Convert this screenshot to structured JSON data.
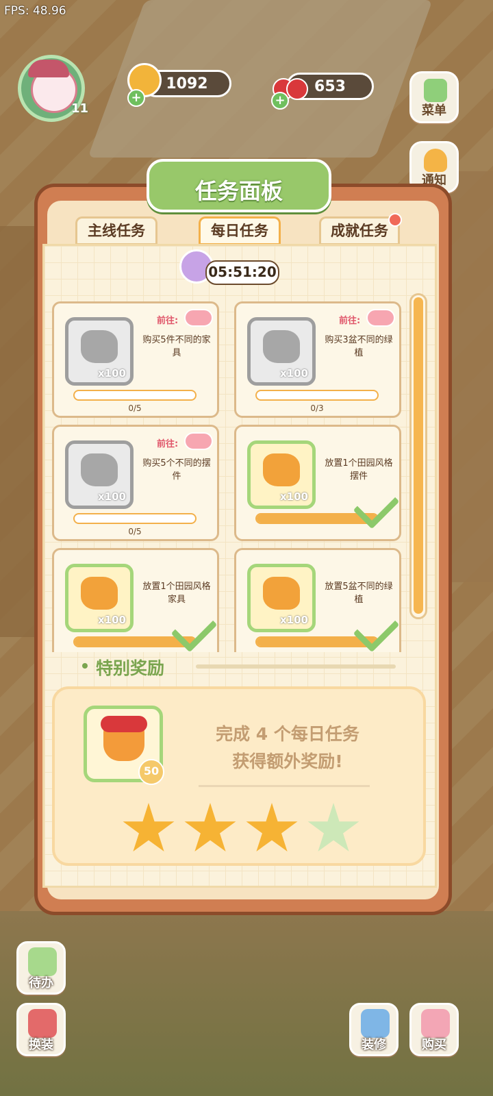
{
  "fps": "FPS: 48.96",
  "player": {
    "level": "11"
  },
  "resources": {
    "coins": "1092",
    "cherries": "653"
  },
  "side_buttons": {
    "menu": "菜单",
    "notice": "通知"
  },
  "panel": {
    "title": "任务面板",
    "tabs": [
      {
        "label": "主线任务"
      },
      {
        "label": "每日任务"
      },
      {
        "label": "成就任务"
      }
    ],
    "timer": "05:51:20",
    "tasks": [
      {
        "desc": "购买5件不同的家具",
        "goto": "前往:",
        "qty": "x100",
        "progress": "0/5",
        "progress_fraction": 0,
        "done": false
      },
      {
        "desc": "购买3盆不同的绿植",
        "goto": "前往:",
        "qty": "x100",
        "progress": "0/3",
        "progress_fraction": 0,
        "done": false
      },
      {
        "desc": "购买5个不同的摆件",
        "goto": "前往:",
        "qty": "x100",
        "progress": "0/5",
        "progress_fraction": 0,
        "done": false
      },
      {
        "desc": "放置1个田园风格摆件",
        "goto": "",
        "qty": "x100",
        "progress": "",
        "progress_fraction": 1,
        "done": true
      },
      {
        "desc": "放置1个田园风格家具",
        "goto": "",
        "qty": "x100",
        "progress": "",
        "progress_fraction": 1,
        "done": true
      },
      {
        "desc": "放置5盆不同的绿植",
        "goto": "",
        "qty": "x100",
        "progress": "",
        "progress_fraction": 1,
        "done": true
      }
    ],
    "special": {
      "label": "特别奖励",
      "reward_qty": "50",
      "text_line1": "完成 4 个每日任务",
      "text_line2": "获得额外奖励!",
      "stars_total": 4,
      "stars_filled": 3
    }
  },
  "bottom_buttons": {
    "todo": "待办",
    "dressup": "换装",
    "decorate": "装修",
    "buy": "购买"
  }
}
